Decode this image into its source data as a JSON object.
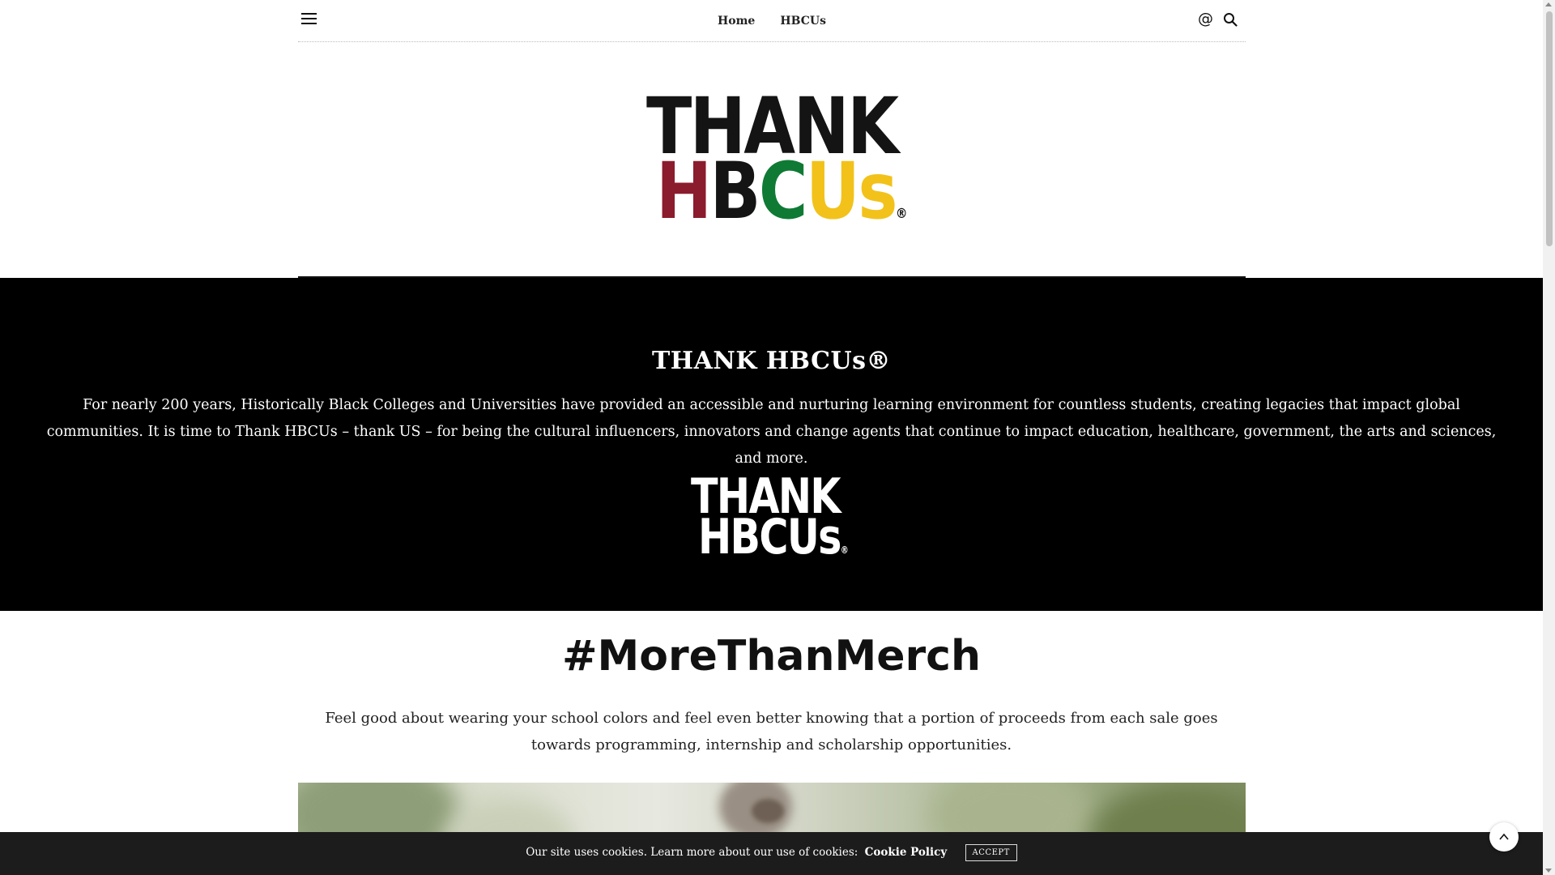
{
  "header": {
    "nav_items": [
      {
        "label": "Home"
      },
      {
        "label": "HBCUs"
      }
    ],
    "menu_icon": "hamburger-menu-icon",
    "email_icon": "at-sign-icon",
    "search_icon": "search-icon"
  },
  "logo": {
    "line1": "THANK",
    "h": "H",
    "b": "B",
    "c": "C",
    "us": "Us",
    "registered": "®",
    "colors": {
      "H": "#8b1c2d",
      "B": "#141414",
      "C": "#0f7a34",
      "Us": "#f2c21b"
    }
  },
  "intro": {
    "title": "THANK HBCUs®",
    "text": "For nearly 200 years, Historically Black Colleges and Universities have provided an accessible and nurturing learning environment for countless students, creating legacies that impact global communities. It is time to Thank HBCUs – thank US – for being the cultural influencers, innovators and change agents that continue to impact education, healthcare, government, the arts and sciences, and more.",
    "logo_line1": "THANK",
    "logo_line2": "HBCUs",
    "logo_registered": "®"
  },
  "merch": {
    "title": "#MoreThanMerch",
    "text": "Feel good about wearing your school colors and feel even better knowing that a portion of proceeds from each sale goes towards programming, internship and scholarship opportunities."
  },
  "cookie": {
    "message": "Our site uses cookies. Learn more about our use of cookies:",
    "link_label": "Cookie Policy",
    "accept_label": "ACCEPT"
  },
  "back_to_top_icon": "chevron-up-icon"
}
